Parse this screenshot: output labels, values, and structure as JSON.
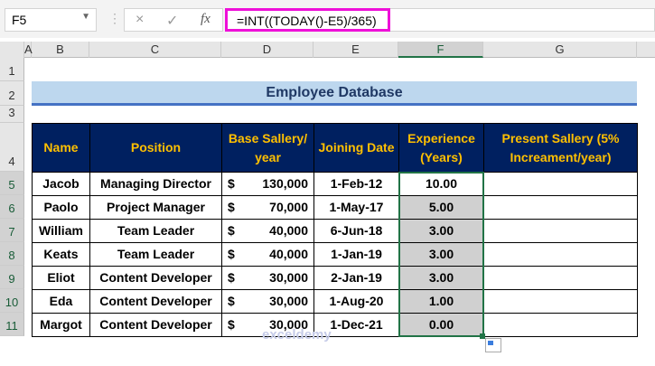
{
  "name_box": "F5",
  "formula_bar": {
    "cancel_icon": "×",
    "enter_icon": "✓",
    "fx_label": "fx",
    "formula": "=INT((TODAY()-E5)/365)"
  },
  "columns": [
    "A",
    "B",
    "C",
    "D",
    "E",
    "F",
    "G"
  ],
  "rows": [
    "1",
    "2",
    "3",
    "4",
    "5",
    "6",
    "7",
    "8",
    "9",
    "10",
    "11"
  ],
  "title": "Employee Database",
  "headers": [
    "Name",
    "Position",
    "Base Sallery/ year",
    "Joining Date",
    "Experience (Years)",
    "Present Sallery (5% Increament/year)"
  ],
  "currency": "$",
  "employees": [
    {
      "name": "Jacob",
      "position": "Managing Director",
      "salary": "130,000",
      "joined": "1-Feb-12",
      "exp": "10.00",
      "present": ""
    },
    {
      "name": "Paolo",
      "position": "Project Manager",
      "salary": "70,000",
      "joined": "1-May-17",
      "exp": "5.00",
      "present": ""
    },
    {
      "name": "William",
      "position": "Team Leader",
      "salary": "40,000",
      "joined": "6-Jun-18",
      "exp": "3.00",
      "present": ""
    },
    {
      "name": "Keats",
      "position": "Team Leader",
      "salary": "40,000",
      "joined": "1-Jan-19",
      "exp": "3.00",
      "present": ""
    },
    {
      "name": "Eliot",
      "position": "Content Developer",
      "salary": "30,000",
      "joined": "2-Jan-19",
      "exp": "3.00",
      "present": ""
    },
    {
      "name": "Eda",
      "position": "Content Developer",
      "salary": "30,000",
      "joined": "1-Aug-20",
      "exp": "1.00",
      "present": ""
    },
    {
      "name": "Margot",
      "position": "Content Developer",
      "salary": "30,000",
      "joined": "1-Dec-21",
      "exp": "0.00",
      "present": ""
    }
  ],
  "watermark": "exceldemy",
  "colors": {
    "header_bg": "#002060",
    "header_text": "#ffc000",
    "title_bg": "#bdd7ee",
    "highlight": "#ee10d8",
    "selection": "#217346"
  }
}
